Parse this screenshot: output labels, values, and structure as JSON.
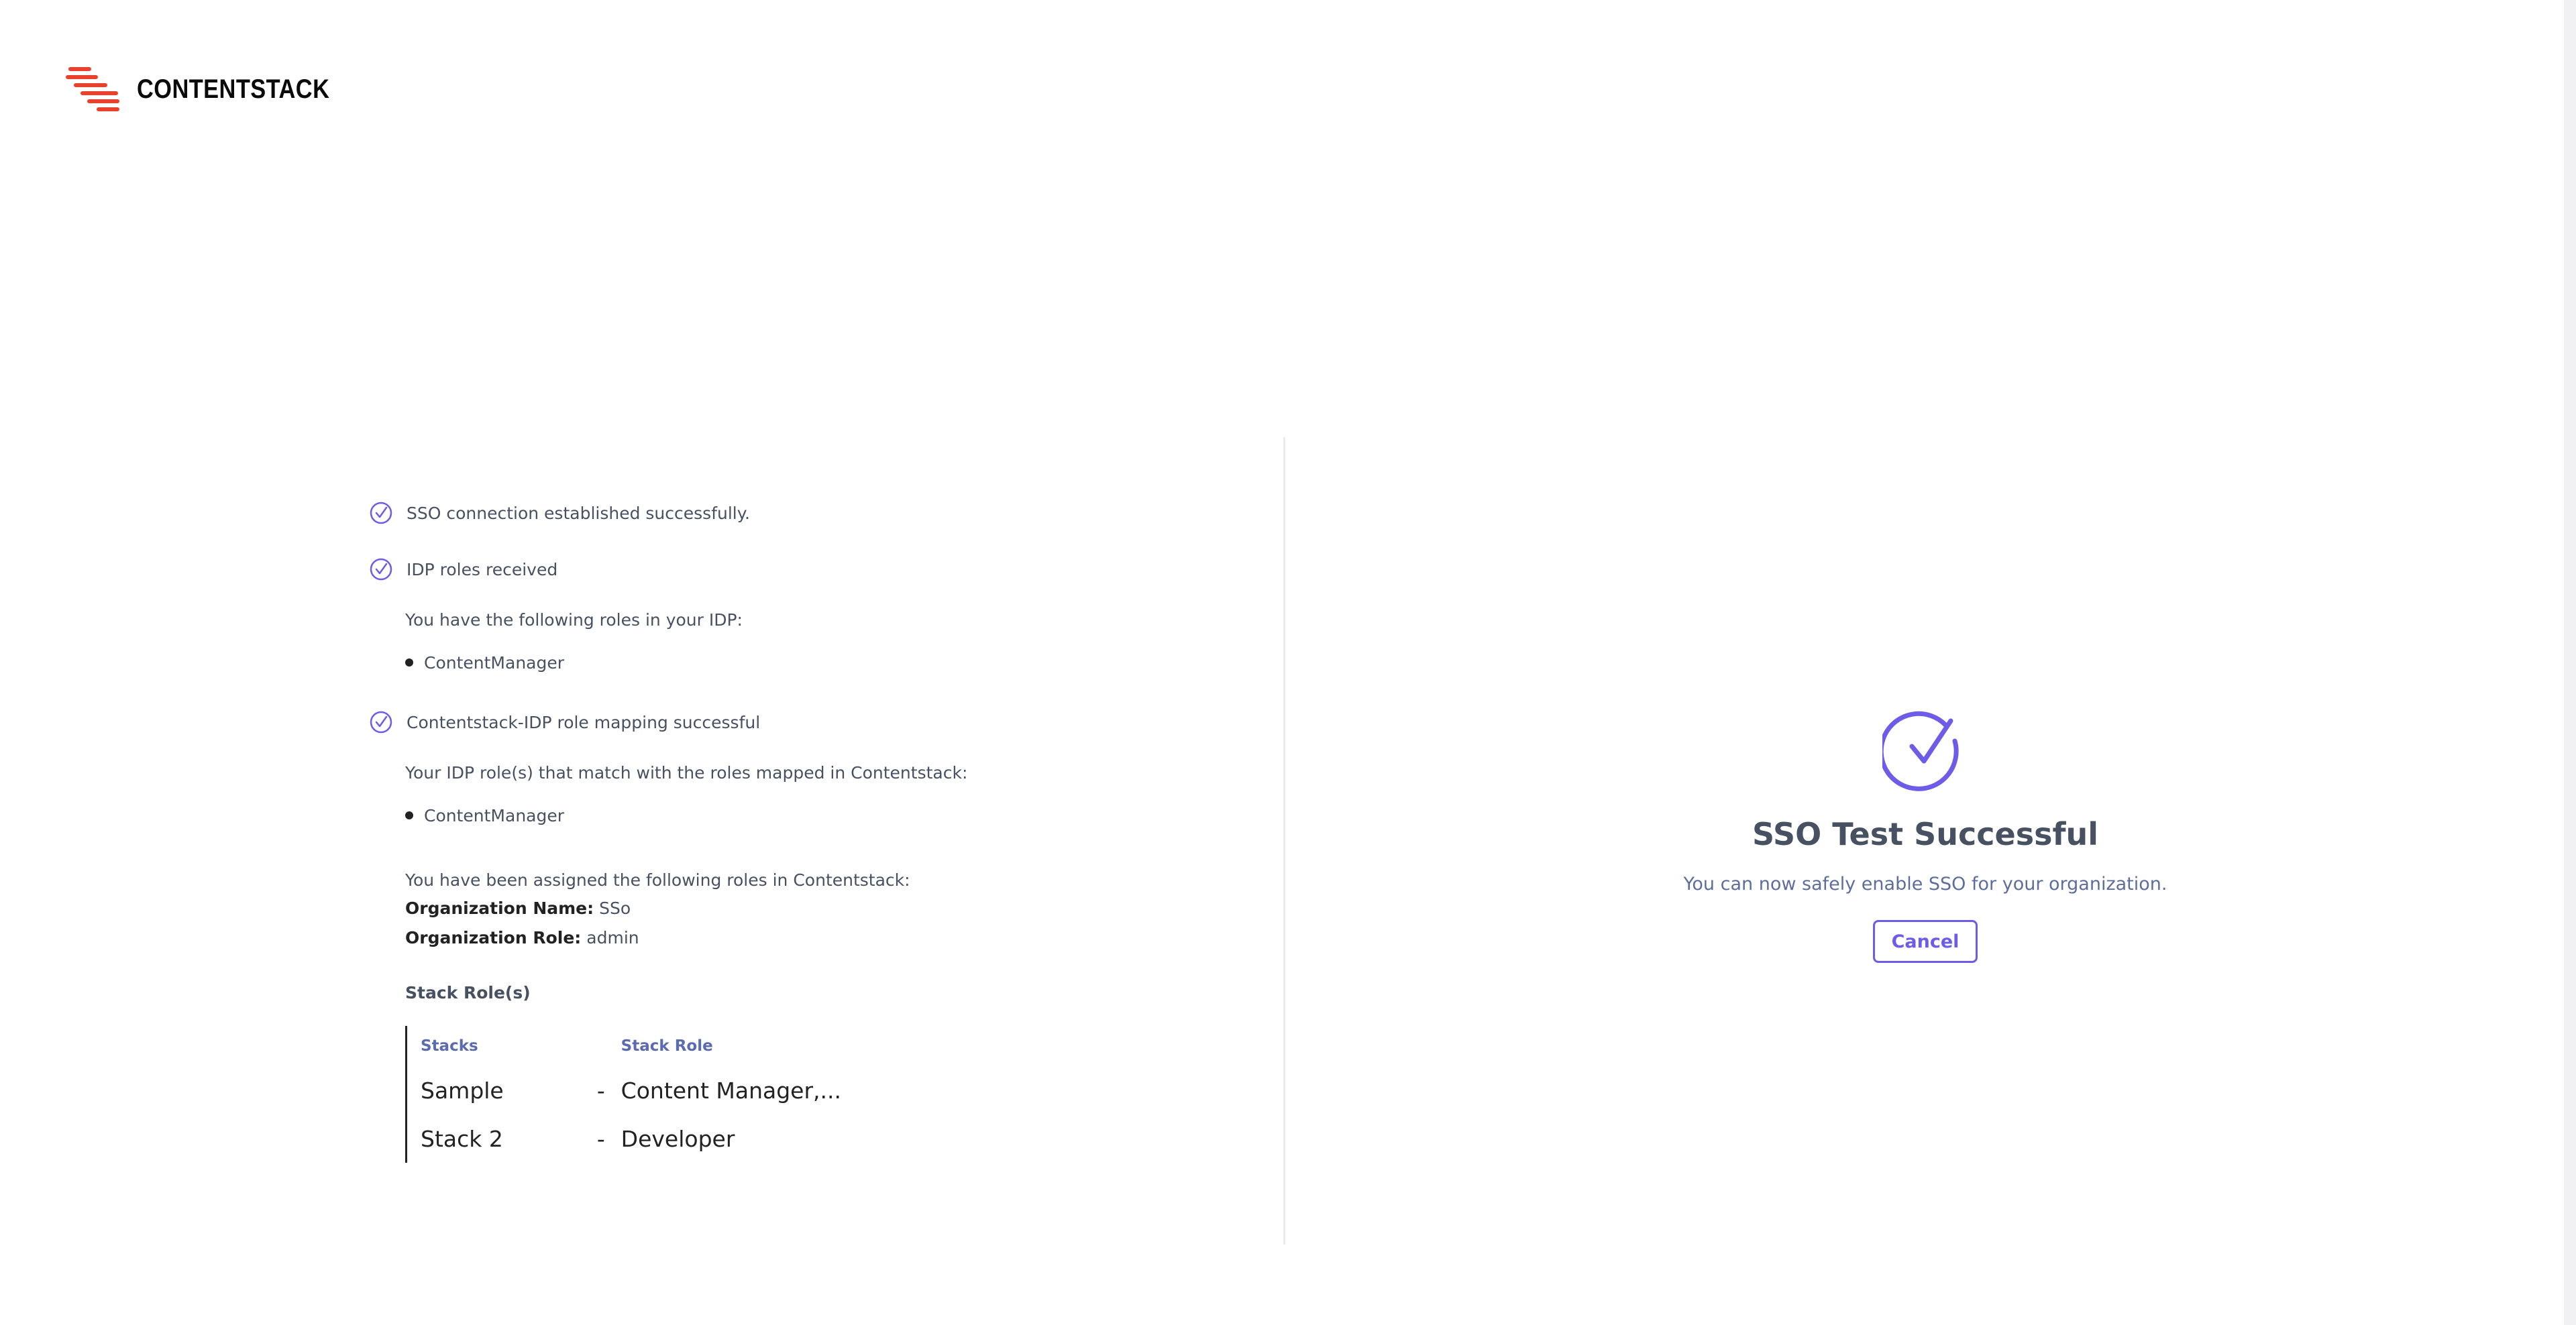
{
  "brand": {
    "name": "CONTENTSTACK",
    "accent": "#e8412e"
  },
  "colors": {
    "purple": "#6c5ce7",
    "text": "#475161",
    "dark": "#222222"
  },
  "left": {
    "check_1": "SSO connection established successfully.",
    "check_2": "IDP roles received",
    "idp_roles_intro": "You have the following roles in your IDP:",
    "idp_roles": [
      "ContentManager"
    ],
    "check_3": "Contentstack-IDP role mapping successful",
    "matched_intro": "Your IDP role(s) that match with the roles mapped in Contentstack:",
    "matched_roles": [
      "ContentManager"
    ],
    "assigned_intro": "You have been assigned the following roles in Contentstack:",
    "org_name_label": "Organization Name:",
    "org_name_value": "SSo",
    "org_role_label": "Organization Role:",
    "org_role_value": "admin",
    "stack_roles_title": "Stack Role(s)",
    "table": {
      "headers": {
        "stacks": "Stacks",
        "stack_role": "Stack Role"
      },
      "rows": [
        {
          "stack": "Sample",
          "dash": "-",
          "role": "Content Manager,..."
        },
        {
          "stack": "Stack 2",
          "dash": "-",
          "role": "Developer"
        }
      ]
    }
  },
  "right": {
    "icon": "check-circle-icon",
    "title": "SSO Test Successful",
    "subtitle": "You can now safely enable SSO for your organization.",
    "cancel_label": "Cancel"
  }
}
